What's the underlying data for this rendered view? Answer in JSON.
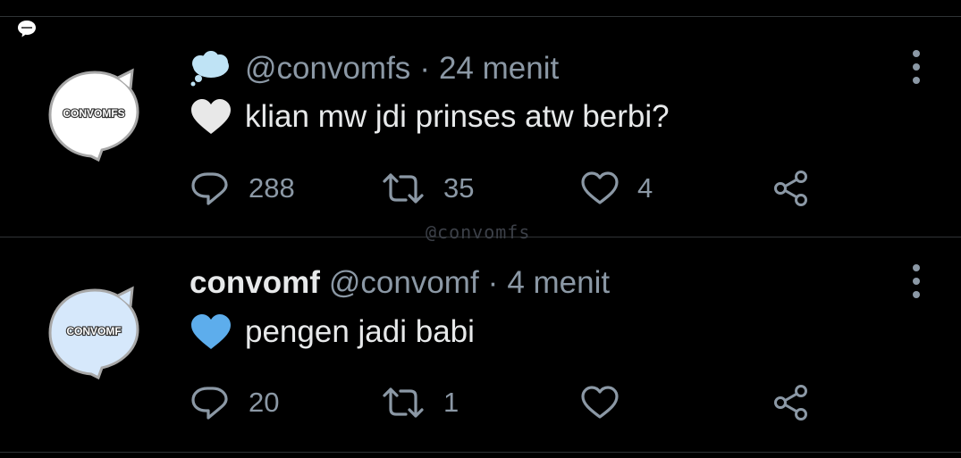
{
  "tweets": [
    {
      "display_name": "",
      "handle": "@convomfs",
      "separator": "·",
      "time": "24 menit",
      "avatar_label": "CONVOMFS",
      "leading_emoji": "thought-balloon-icon",
      "heart_emoji": "white-heart-icon",
      "text": "klian mw jdi prinses atw berbi?",
      "replies": "288",
      "retweets": "35",
      "likes": "4"
    },
    {
      "display_name": "convomf",
      "handle": "@convomf",
      "separator": "·",
      "time": "4 menit",
      "avatar_label": "CONVOMF",
      "heart_emoji": "blue-heart-icon",
      "text": "pengen jadi babi",
      "replies": "20",
      "retweets": "1",
      "likes": ""
    }
  ],
  "watermark": "@convomfs",
  "colors": {
    "background": "#000000",
    "text": "#e7e9ea",
    "secondary": "#8b98a5",
    "divider": "#2f3336",
    "blue_heart": "#5dadec",
    "white_heart": "#e8e8e8",
    "cloud": "#bfe3f5",
    "avatar2_fill": "#d6e8fb"
  }
}
